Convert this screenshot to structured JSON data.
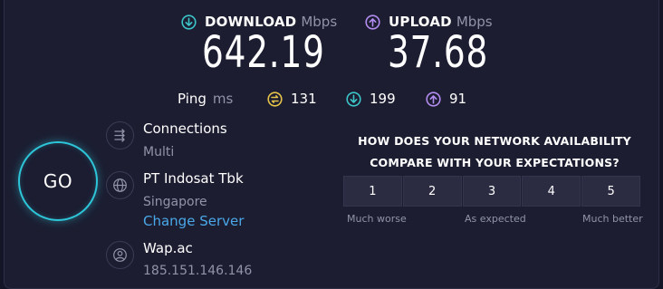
{
  "download": {
    "label": "DOWNLOAD",
    "unit": "Mbps",
    "value": "642.19",
    "icon": "arrow-down-circle-icon",
    "color": "#3cc5c9"
  },
  "upload": {
    "label": "UPLOAD",
    "unit": "Mbps",
    "value": "37.68",
    "icon": "arrow-up-circle-icon",
    "color": "#b38cf0"
  },
  "ping": {
    "label": "Ping",
    "unit": "ms",
    "idle": {
      "value": "131",
      "icon": "ping-idle-icon",
      "color": "#e6c44a"
    },
    "download": {
      "value": "199",
      "icon": "arrow-down-circle-icon",
      "color": "#3cc5c9"
    },
    "upload": {
      "value": "91",
      "icon": "arrow-up-circle-icon",
      "color": "#b38cf0"
    }
  },
  "go_button": {
    "label": "GO",
    "color": "#2ec5d8"
  },
  "connections": {
    "title": "Connections",
    "value": "Multi",
    "icon": "connections-icon"
  },
  "isp": {
    "title": "PT Indosat Tbk",
    "location": "Singapore",
    "change_server": "Change Server",
    "icon": "globe-icon",
    "link_color": "#4aa8e8"
  },
  "host": {
    "title": "Wap.ac",
    "ip": "185.151.146.146",
    "icon": "user-icon"
  },
  "survey": {
    "question_line1": "HOW DOES YOUR NETWORK AVAILABILITY",
    "question_line2": "COMPARE WITH YOUR EXPECTATIONS?",
    "options": [
      "1",
      "2",
      "3",
      "4",
      "5"
    ],
    "low_label": "Much worse",
    "mid_label": "As expected",
    "high_label": "Much better"
  }
}
